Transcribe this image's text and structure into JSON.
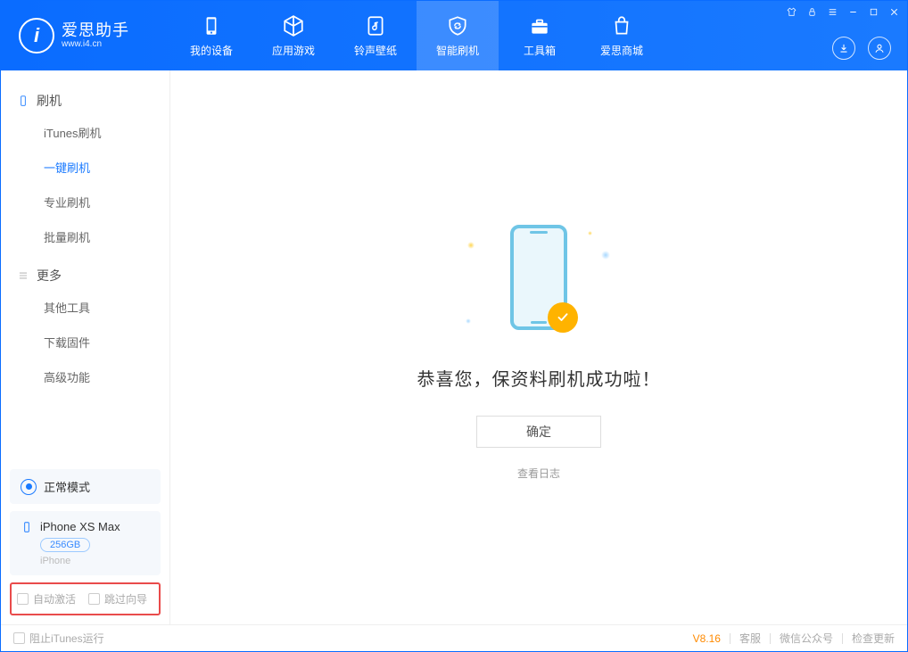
{
  "app": {
    "name": "爱思助手",
    "url": "www.i4.cn"
  },
  "nav": {
    "items": [
      {
        "label": "我的设备"
      },
      {
        "label": "应用游戏"
      },
      {
        "label": "铃声壁纸"
      },
      {
        "label": "智能刷机"
      },
      {
        "label": "工具箱"
      },
      {
        "label": "爱思商城"
      }
    ]
  },
  "sidebar": {
    "sec1_title": "刷机",
    "sec1_items": [
      "iTunes刷机",
      "一键刷机",
      "专业刷机",
      "批量刷机"
    ],
    "sec2_title": "更多",
    "sec2_items": [
      "其他工具",
      "下载固件",
      "高级功能"
    ],
    "mode_label": "正常模式",
    "device": {
      "name": "iPhone XS Max",
      "capacity": "256GB",
      "type": "iPhone"
    },
    "options": {
      "auto_activate": "自动激活",
      "skip_guide": "跳过向导"
    }
  },
  "main": {
    "success_msg": "恭喜您，保资料刷机成功啦！",
    "ok_button": "确定",
    "log_link": "查看日志"
  },
  "footer": {
    "block_itunes": "阻止iTunes运行",
    "version": "V8.16",
    "links": [
      "客服",
      "微信公众号",
      "检查更新"
    ]
  }
}
